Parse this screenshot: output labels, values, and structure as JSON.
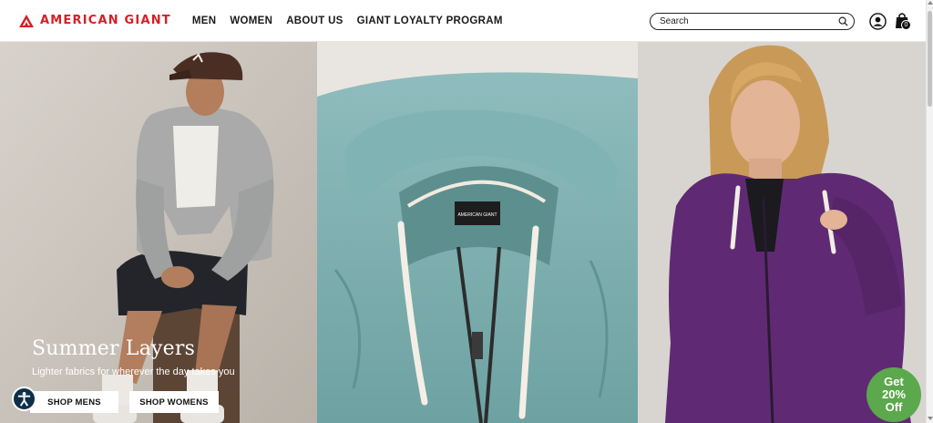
{
  "brand": {
    "name": "AMERICAN GIANT",
    "color": "#d61f26"
  },
  "nav": {
    "items": [
      "MEN",
      "WOMEN",
      "ABOUT US",
      "GIANT LOYALTY PROGRAM"
    ]
  },
  "search": {
    "placeholder": "Search",
    "icon": "magnifier"
  },
  "header_icons": {
    "account": "person-icon",
    "cart": "bag-icon",
    "cart_count": "0"
  },
  "hero": {
    "title": "Summer Layers",
    "subtitle": "Lighter fabrics for wherever the day takes you",
    "buttons": {
      "mens": "SHOP MENS",
      "womens": "SHOP WOMENS"
    },
    "images": [
      "man-in-grey-hoodie",
      "teal-zip-hoodie-closeup",
      "woman-in-purple-hoodie"
    ],
    "label_on_hoodie": "AMERICAN GIANT"
  },
  "promo": {
    "line1": "Get",
    "line2": "20%",
    "line3": "Off",
    "color": "#5ca84c"
  },
  "accessibility": {
    "icon": "accessibility-icon"
  }
}
